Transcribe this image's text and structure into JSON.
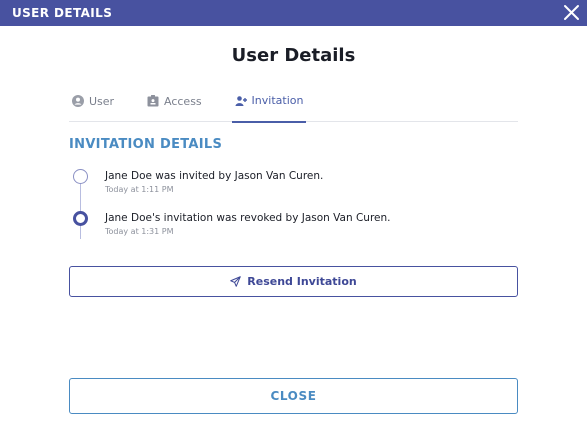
{
  "window": {
    "title": "USER DETAILS",
    "close_icon": "close-icon"
  },
  "dialog": {
    "heading": "User Details"
  },
  "tabs": [
    {
      "label": "User",
      "icon": "user-circle-icon",
      "active": false
    },
    {
      "label": "Access",
      "icon": "badge-icon",
      "active": false
    },
    {
      "label": "Invitation",
      "icon": "user-plus-icon",
      "active": true
    }
  ],
  "invitation": {
    "section_title": "INVITATION DETAILS",
    "events": [
      {
        "message": "Jane Doe was invited by Jason Van Curen.",
        "time": "Today at 1:11 PM"
      },
      {
        "message": "Jane Doe's invitation was revoked by Jason Van Curen.",
        "time": "Today at 1:31 PM"
      }
    ],
    "resend_label": "Resend Invitation",
    "resend_icon": "paper-plane-icon"
  },
  "footer": {
    "close_label": "CLOSE"
  },
  "colors": {
    "titlebar": "#4852a0",
    "accent": "#4a8bc2",
    "active_tab": "#4a5ea8"
  }
}
